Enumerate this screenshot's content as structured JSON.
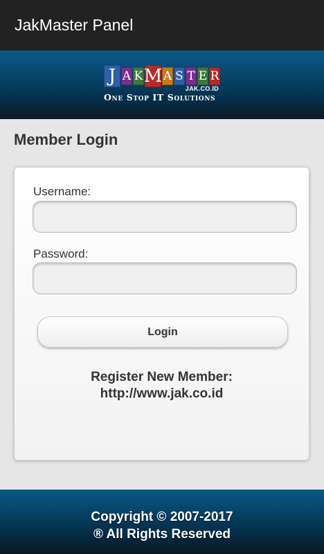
{
  "appbar": {
    "title": "JakMaster Panel"
  },
  "banner": {
    "logo_letters": [
      "J",
      "A",
      "K",
      "M",
      "A",
      "S",
      "T",
      "E",
      "R"
    ],
    "logo_domain": "JAK.CO.ID",
    "tagline": "One Stop IT Solutions"
  },
  "page": {
    "title": "Member Login"
  },
  "form": {
    "username_label": "Username:",
    "username_value": "",
    "password_label": "Password:",
    "password_value": "",
    "login_label": "Login"
  },
  "register": {
    "line1": "Register New Member:",
    "line2": "http://www.jak.co.id"
  },
  "footer": {
    "line1": "Copyright © 2007-2017",
    "line2": "® All Rights Reserved"
  },
  "colors": {
    "appbar_bg": "#222222",
    "banner_blue": "#074469",
    "page_bg": "#e6e6e6",
    "logo_tiles": [
      "#2f5fa8",
      "#7a2e8e",
      "#3a7a3a",
      "#b62a2a",
      "#c77a18",
      "#2f5fa8",
      "#7a2e8e",
      "#3a7a3a",
      "#b62a2a"
    ]
  }
}
